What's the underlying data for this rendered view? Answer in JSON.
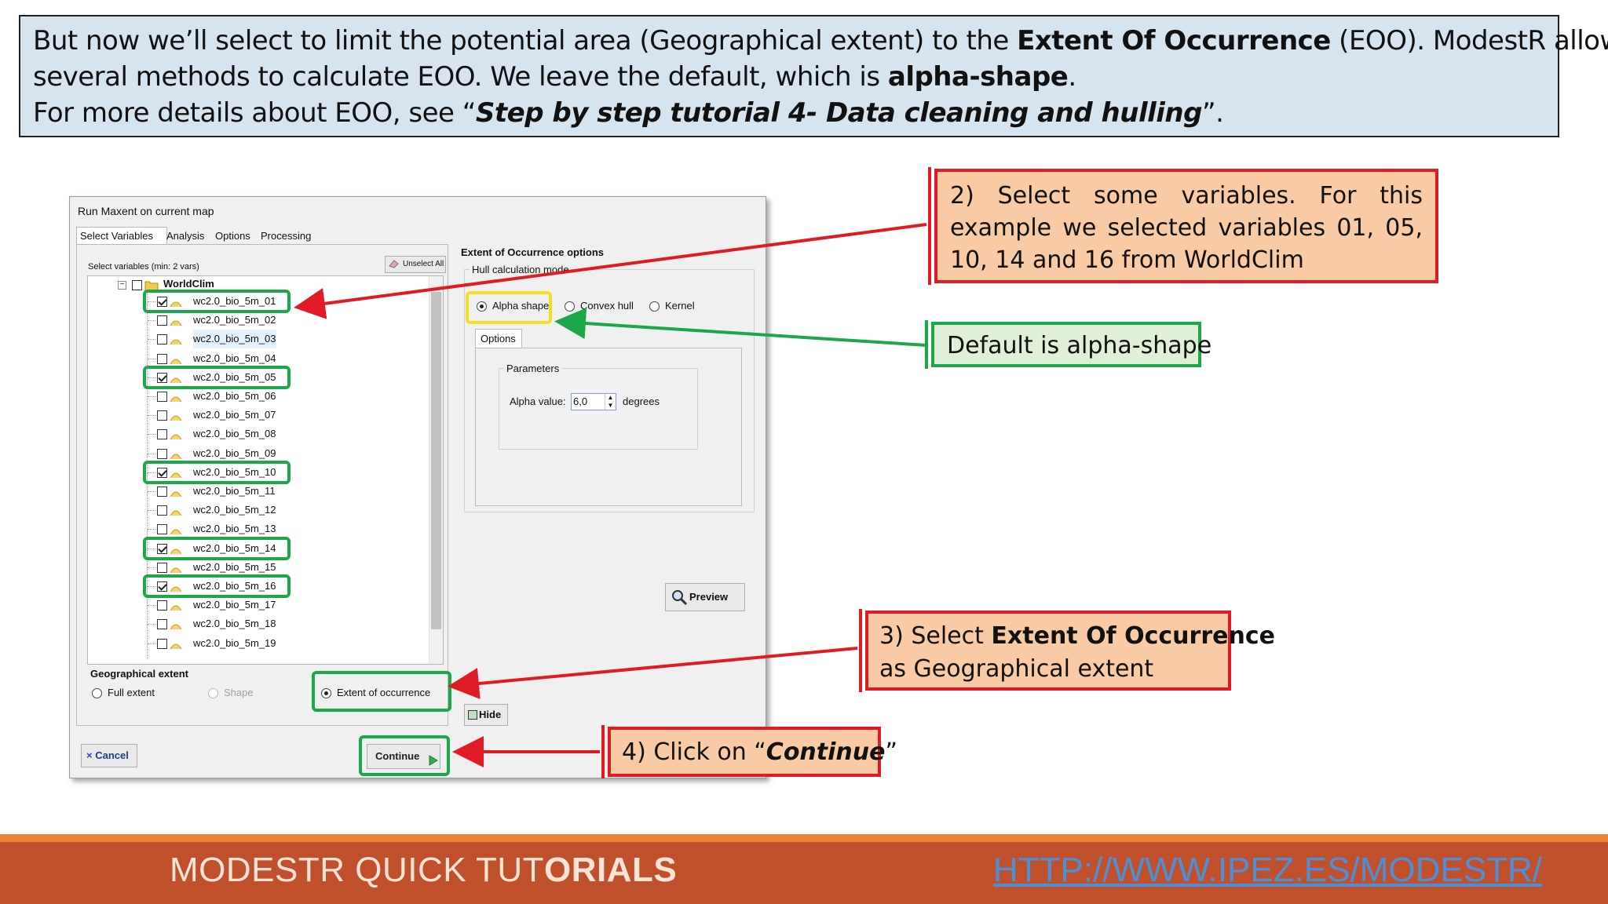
{
  "intro": {
    "line1_pre": "But now we’ll select to limit the potential area (Geographical extent) to the ",
    "line1_bold": "Extent Of Occurrence",
    "line1_post": " (EOO).  ModestR allows",
    "line2_pre": "several methods to calculate EOO. We leave the default, which is ",
    "line2_bold": "alpha-shape",
    "line2_post": ".",
    "line3_pre": "For more details about EOO, see “",
    "line3_bold": "Step by step tutorial 4- Data cleaning and hulling",
    "line3_post": "”."
  },
  "dialog": {
    "title": "Run Maxent on current map",
    "tabs": [
      "Select Variables",
      "Analysis",
      "Options",
      "Processing"
    ],
    "select_vars_label": "Select variables (min: 2 vars)",
    "unselect_all": "Unselect All",
    "tree_root": "WorldClim",
    "variables": [
      {
        "name": "wc2.0_bio_5m_01",
        "checked": true
      },
      {
        "name": "wc2.0_bio_5m_02",
        "checked": false
      },
      {
        "name": "wc2.0_bio_5m_03",
        "checked": false
      },
      {
        "name": "wc2.0_bio_5m_04",
        "checked": false
      },
      {
        "name": "wc2.0_bio_5m_05",
        "checked": true
      },
      {
        "name": "wc2.0_bio_5m_06",
        "checked": false
      },
      {
        "name": "wc2.0_bio_5m_07",
        "checked": false
      },
      {
        "name": "wc2.0_bio_5m_08",
        "checked": false
      },
      {
        "name": "wc2.0_bio_5m_09",
        "checked": false
      },
      {
        "name": "wc2.0_bio_5m_10",
        "checked": true
      },
      {
        "name": "wc2.0_bio_5m_11",
        "checked": false
      },
      {
        "name": "wc2.0_bio_5m_12",
        "checked": false
      },
      {
        "name": "wc2.0_bio_5m_13",
        "checked": false
      },
      {
        "name": "wc2.0_bio_5m_14",
        "checked": true
      },
      {
        "name": "wc2.0_bio_5m_15",
        "checked": false
      },
      {
        "name": "wc2.0_bio_5m_16",
        "checked": true
      },
      {
        "name": "wc2.0_bio_5m_17",
        "checked": false
      },
      {
        "name": "wc2.0_bio_5m_18",
        "checked": false
      },
      {
        "name": "wc2.0_bio_5m_19",
        "checked": false
      }
    ],
    "geo_extent_label": "Geographical extent",
    "geo_full": "Full extent",
    "geo_shape": "Shape",
    "geo_eoo": "Extent of occurrence",
    "cancel": "Cancel",
    "continue": "Continue",
    "eoo_options_title": "Extent of Occurrence options",
    "hull_mode_label": "Hull calculation mode",
    "hull_alpha": "Alpha shape",
    "hull_convex": "Convex hull",
    "hull_kernel": "Kernel",
    "options_tab": "Options",
    "parameters_label": "Parameters",
    "alpha_value_label": "Alpha value:",
    "alpha_value": "6,0",
    "alpha_unit": "degrees",
    "preview": "Preview",
    "hide": "Hide"
  },
  "callouts": {
    "c2": "2) Select some variables. For this example we selected variables 01, 05, 10, 14 and 16 from WorldClim",
    "default": "Default is alpha-shape",
    "c3_pre": "3) Select ",
    "c3_bold": "Extent Of Occurrence",
    "c3_post": "as Geographical extent",
    "c4_pre": "4) Click on “",
    "c4_bold": "Continue",
    "c4_post": "”"
  },
  "footer": {
    "title_light": "MODESTR QUICK TUT",
    "title_bold": "ORIALS",
    "link": "HTTP://WWW.IPEZ.ES/MODESTR/"
  },
  "colors": {
    "highlight_green": "#1aa84a",
    "highlight_yellow": "#f0e020",
    "arrow_red": "#e01b24",
    "callout_fill": "#f9cba5",
    "footer_bg": "#c0502c",
    "intro_bg": "#d6e4ef"
  }
}
